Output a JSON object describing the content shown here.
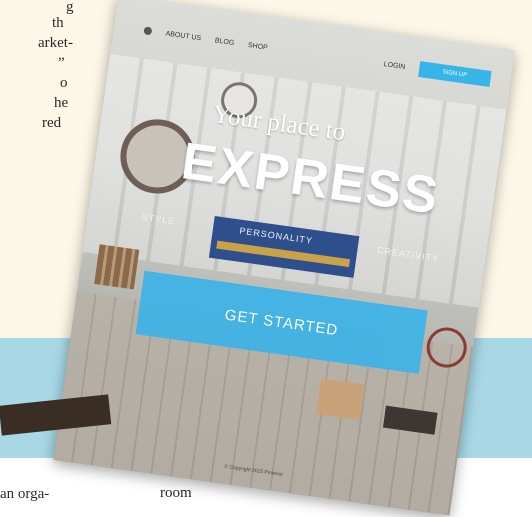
{
  "article_fragments": {
    "frag_1": "g",
    "frag_2": "th",
    "frag_3": "arket-",
    "frag_4": "”",
    "frag_5": "o",
    "frag_6": "he",
    "frag_7": "red",
    "bottom_left": "an orga-",
    "bottom_mid": "room"
  },
  "screenshot": {
    "nav": {
      "links": [
        "ABOUT US",
        "BLOG",
        "SHOP"
      ],
      "login": "LOGIN",
      "cta": "SIGN UP"
    },
    "hero": {
      "line1": "Your place to",
      "line2": "EXPRESS",
      "tags": [
        "STYLE",
        "PERSONALITY",
        "CREATIVITY"
      ],
      "cta": "GET STARTED"
    },
    "footer": "© Copyright 2015 Pinterior"
  },
  "colors": {
    "page_bg": "#fdf7e7",
    "band_blue": "#a8d8e6",
    "accent_blue": "#3fb3e6"
  }
}
